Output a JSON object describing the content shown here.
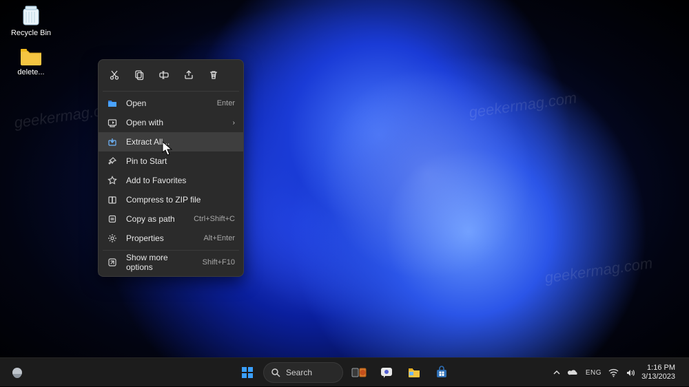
{
  "desktop": {
    "recycle_bin_label": "Recycle Bin",
    "folder_label": "delete..."
  },
  "context_menu": {
    "icon_row": [
      "cut-icon",
      "copy-icon",
      "rename-icon",
      "share-icon",
      "delete-icon"
    ],
    "items": [
      {
        "icon": "open-icon",
        "label": "Open",
        "accel": "Enter",
        "submenu": false
      },
      {
        "icon": "open-with-icon",
        "label": "Open with",
        "accel": "",
        "submenu": true
      },
      {
        "icon": "extract-icon",
        "label": "Extract All...",
        "accel": "",
        "submenu": false,
        "hover": true
      },
      {
        "icon": "pin-start-icon",
        "label": "Pin to Start",
        "accel": "",
        "submenu": false
      },
      {
        "icon": "star-icon",
        "label": "Add to Favorites",
        "accel": "",
        "submenu": false
      },
      {
        "icon": "zip-icon",
        "label": "Compress to ZIP file",
        "accel": "",
        "submenu": false
      },
      {
        "icon": "copy-path-icon",
        "label": "Copy as path",
        "accel": "Ctrl+Shift+C",
        "submenu": false
      },
      {
        "icon": "properties-icon",
        "label": "Properties",
        "accel": "Alt+Enter",
        "submenu": false
      }
    ],
    "more_item": {
      "icon": "more-icon",
      "label": "Show more options",
      "accel": "Shift+F10"
    }
  },
  "taskbar": {
    "search_label": "Search",
    "time": "1:16 PM",
    "date": "3/13/2023"
  },
  "watermark": "geekermag.com"
}
